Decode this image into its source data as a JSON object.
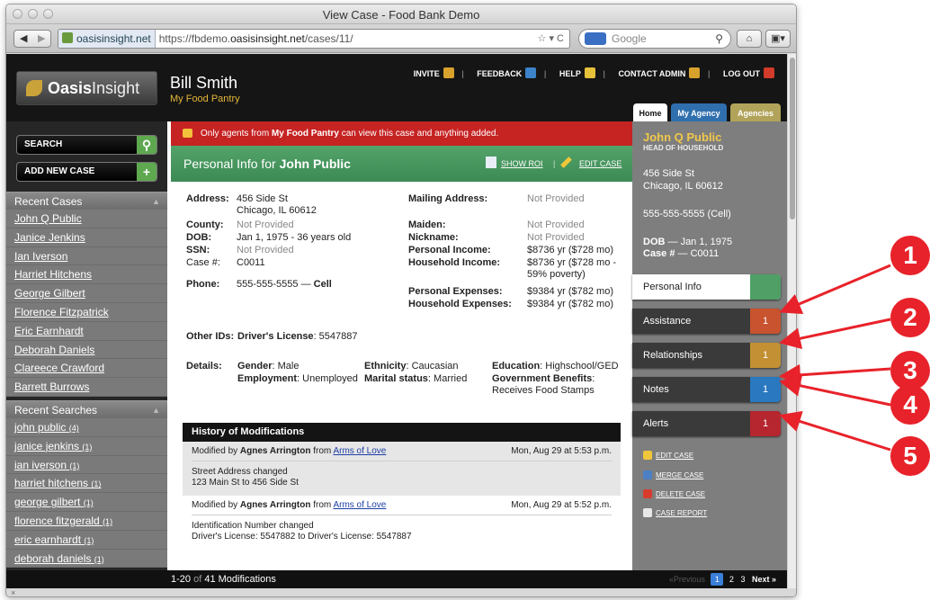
{
  "window": {
    "title": "View Case - Food Bank Demo"
  },
  "browser": {
    "url_domain": "oasisinsight.net",
    "url_prefix": "https://fbdemo.",
    "url_host": "oasisinsight.net",
    "url_path": "/cases/11/",
    "search_placeholder": "Google"
  },
  "header": {
    "logo_bold": "Oasis",
    "logo_light": "Insight",
    "user_name": "Bill Smith",
    "pantry": "My Food Pantry",
    "nav": {
      "invite": "INVITE",
      "feedback": "FEEDBACK",
      "help": "HELP",
      "contact": "CONTACT ADMIN",
      "logout": "LOG OUT"
    },
    "tabs": [
      "Home",
      "My Agency",
      "Agencies"
    ]
  },
  "sidebar": {
    "search_label": "SEARCH",
    "add_label": "ADD NEW CASE",
    "recent_cases_title": "Recent Cases",
    "recent_cases": [
      "John Q Public",
      "Janice Jenkins",
      "Ian Iverson",
      "Harriet Hitchens",
      "George Gilbert",
      "Florence Fitzpatrick",
      "Eric Earnhardt",
      "Deborah Daniels",
      "Clareece Crawford",
      "Barrett Burrows"
    ],
    "recent_searches_title": "Recent Searches",
    "recent_searches": [
      {
        "term": "john public",
        "count": "(4)"
      },
      {
        "term": "janice jenkins",
        "count": "(1)"
      },
      {
        "term": "ian iverson",
        "count": "(1)"
      },
      {
        "term": "harriet hitchens",
        "count": "(1)"
      },
      {
        "term": "george gilbert",
        "count": "(1)"
      },
      {
        "term": "florence fitzgerald",
        "count": "(1)"
      },
      {
        "term": "eric earnhardt",
        "count": "(1)"
      },
      {
        "term": "deborah daniels",
        "count": "(1)"
      }
    ]
  },
  "alert": {
    "pre": "Only agents from ",
    "bold": "My Food Pantry",
    "post": " can view this case and anything added."
  },
  "info": {
    "title_pre": "Personal Info for ",
    "title_name": "John Public",
    "show_roi": "SHOW ROI",
    "edit_case": "EDIT CASE",
    "address_label": "Address:",
    "address_1": "456 Side St",
    "address_2": "Chicago, IL 60612",
    "county_label": "County:",
    "county": "Not Provided",
    "dob_label": "DOB:",
    "dob": "Jan 1, 1975 - 36 years old",
    "ssn_label": "SSN:",
    "ssn": "Not Provided",
    "case_label": "Case #:",
    "case": "C0011",
    "phone_label": "Phone:",
    "phone": "555-555-5555",
    "phone_type": "Cell",
    "mailing_label": "Mailing Address:",
    "mailing": "Not Provided",
    "maiden_label": "Maiden:",
    "maiden": "Not Provided",
    "nickname_label": "Nickname:",
    "nickname": "Not Provided",
    "pincome_label": "Personal Income:",
    "pincome": "$8736 yr ($728 mo)",
    "hincome_label": "Household Income:",
    "hincome_1": "$8736 yr ($728 mo -",
    "hincome_2": "59% poverty)",
    "pexp_label": "Personal Expenses:",
    "pexp": "$9384 yr ($782 mo)",
    "hexp_label": "Household Expenses:",
    "hexp": "$9384 yr ($782 mo)",
    "otherids_label": "Other IDs:",
    "otherids_key": "Driver's License",
    "otherids_val": ": 5547887",
    "details_label": "Details:",
    "gender_key": "Gender",
    "gender": ": Male",
    "employment_key": "Employment",
    "employment": ": Unemployed",
    "ethnicity_key": "Ethnicity",
    "ethnicity": ": Caucasian",
    "marital_key": "Marital status",
    "marital": ": Married",
    "education_key": "Education",
    "education": ": Highschool/GED",
    "benefits_key": "Government Benefits",
    "benefits_1": ":",
    "benefits_2": "Receives Food Stamps"
  },
  "history": {
    "title": "History of Modifications",
    "items": [
      {
        "by_pre": "Modified by ",
        "by": "Agnes Arrington",
        "from_pre": " from ",
        "from": "Arms of Love",
        "date": "Mon, Aug 29 at 5:53 p.m.",
        "line1": "Street Address changed",
        "line2": "123 Main St to 456 Side St"
      },
      {
        "by_pre": "Modified by ",
        "by": "Agnes Arrington",
        "from_pre": " from ",
        "from": "Arms of Love",
        "date": "Mon, Aug 29 at 5:52 p.m.",
        "line1": "Identification Number changed",
        "line2": "Driver's License: 5547882 to Driver's License: 5547887"
      }
    ]
  },
  "footer": {
    "range": "1-20",
    "of": "of",
    "total": "41 Modifications",
    "prev": "«Previous",
    "pages": [
      "1",
      "2",
      "3"
    ],
    "next": "Next »"
  },
  "right_panel": {
    "name": "John Q Public",
    "role": "HEAD OF HOUSEHOLD",
    "addr1": "456 Side St",
    "addr2": "Chicago, IL  60612",
    "phone": "555-555-5555 (Cell)",
    "dob_label": "DOB",
    "dob": " — Jan 1, 1975",
    "case_label": "Case #",
    "case": "  —  C0011",
    "buttons": [
      {
        "label": "Personal Info",
        "count": "",
        "color": "#4f9f66"
      },
      {
        "label": "Assistance",
        "count": "1",
        "color": "#c8532e"
      },
      {
        "label": "Relationships",
        "count": "1",
        "color": "#c39034"
      },
      {
        "label": "Notes",
        "count": "1",
        "color": "#2a79c0"
      },
      {
        "label": "Alerts",
        "count": "1",
        "color": "#b5262f"
      }
    ],
    "actions": [
      "EDIT CASE",
      "MERGE CASE",
      "DELETE CASE",
      "CASE REPORT"
    ]
  },
  "markers": [
    "1",
    "2",
    "3",
    "4",
    "5"
  ],
  "colors": {
    "header": "#151515",
    "alert": "#c62323",
    "green": "#4f9f66",
    "marker": "#e8222a",
    "pantry": "#e4b73a"
  }
}
